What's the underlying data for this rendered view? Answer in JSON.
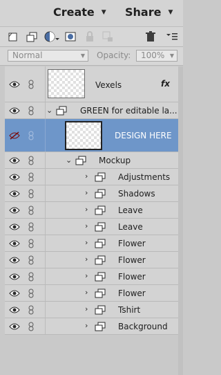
{
  "topbar": {
    "create_label": "Create",
    "share_label": "Share"
  },
  "options": {
    "blend_mode": "Normal",
    "opacity_label": "Opacity:",
    "opacity_value": "100%"
  },
  "layers": [
    {
      "name": "Vexels",
      "fx": "fx",
      "kind": "thumb"
    },
    {
      "name": "GREEN for editable la...",
      "kind": "group-open"
    },
    {
      "name": "DESIGN HERE",
      "kind": "thumb-selected",
      "hidden": true
    },
    {
      "name": "Mockup",
      "kind": "group-open"
    },
    {
      "name": "Adjustments",
      "kind": "group"
    },
    {
      "name": "Shadows",
      "kind": "group"
    },
    {
      "name": "Leave",
      "kind": "group"
    },
    {
      "name": "Leave",
      "kind": "group"
    },
    {
      "name": "Flower",
      "kind": "group"
    },
    {
      "name": "Flower",
      "kind": "group"
    },
    {
      "name": "Flower",
      "kind": "group"
    },
    {
      "name": "Flower",
      "kind": "group"
    },
    {
      "name": "Tshirt",
      "kind": "group"
    },
    {
      "name": "Background",
      "kind": "group"
    }
  ],
  "icons": [
    "new-layer-icon",
    "new-group-icon",
    "adjustment-layer-icon",
    "mask-icon",
    "lock-icon",
    "lock-all-icon",
    "trash-icon",
    "panel-menu-icon",
    "eye-icon",
    "link-icon",
    "chevron-right-icon",
    "chevron-down-icon",
    "group-icon",
    "fx-icon"
  ]
}
